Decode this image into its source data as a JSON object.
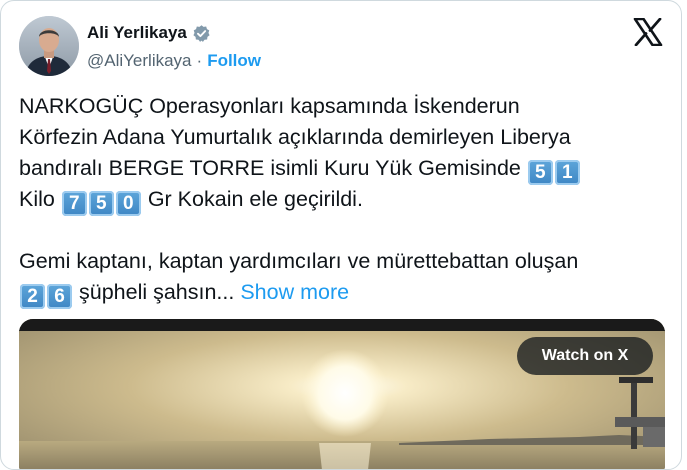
{
  "author": {
    "display_name": "Ali Yerlikaya",
    "handle": "@AliYerlikaya",
    "separator": "·",
    "follow_label": "Follow",
    "verified_icon": "verified-badge-icon"
  },
  "brand_icon": "x-logo-icon",
  "tweet": {
    "line1": "NARKOGÜÇ Operasyonları kapsamında İskenderun",
    "line2": "Körfezin Adana Yumurtalık açıklarında demirleyen Liberya",
    "line3_text": "bandıralı BERGE TORRE isimli Kuru Yük Gemisinde",
    "line3_digits": [
      "5",
      "1"
    ],
    "line4_text_before": "Kilo",
    "line4_digits": [
      "7",
      "5",
      "0"
    ],
    "line4_text_after": "Gr Kokain ele geçirildi.",
    "line5": "Gemi kaptanı, kaptan yardımcıları ve mürettebattan oluşan",
    "line6_digits": [
      "2",
      "6"
    ],
    "line6_text": "şüpheli şahsın...",
    "show_more_label": "Show more"
  },
  "media": {
    "watch_label": "Watch on X"
  },
  "colors": {
    "link": "#1d9bf0",
    "text": "#0f1419",
    "muted": "#536471",
    "keycap": "#3e86c4"
  }
}
